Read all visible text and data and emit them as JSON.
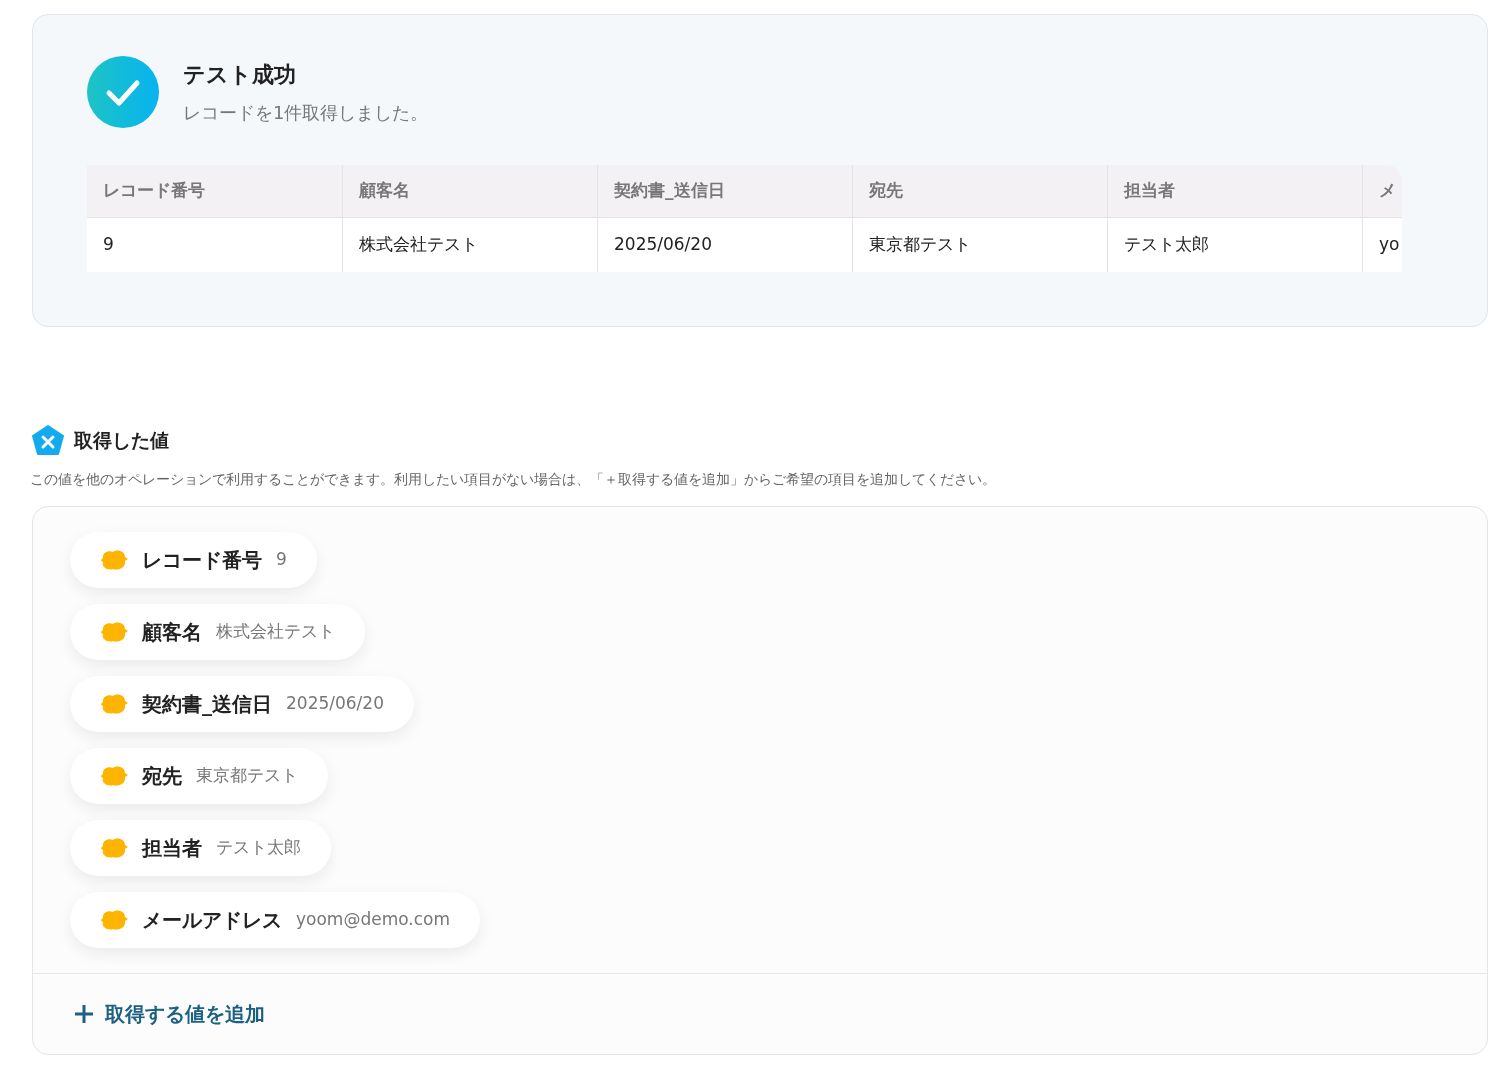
{
  "result": {
    "title": "テスト成功",
    "message": "レコードを1件取得しました。"
  },
  "table": {
    "columns": [
      "レコード番号",
      "顧客名",
      "契約書_送信日",
      "宛先",
      "担当者",
      "メ"
    ],
    "rows": [
      [
        "9",
        "株式会社テスト",
        "2025/06/20",
        "東京都テスト",
        "テスト太郎",
        "yo"
      ]
    ]
  },
  "values_section": {
    "title": "取得した値",
    "description": "この値を他のオペレーションで利用することができます。利用したい項目がない場合は、「＋取得する値を追加」からご希望の項目を追加してください。",
    "items": [
      {
        "label": "レコード番号",
        "value": "9"
      },
      {
        "label": "顧客名",
        "value": "株式会社テスト"
      },
      {
        "label": "契約書_送信日",
        "value": "2025/06/20"
      },
      {
        "label": "宛先",
        "value": "東京都テスト"
      },
      {
        "label": "担当者",
        "value": "テスト太郎"
      },
      {
        "label": "メールアドレス",
        "value": "yoom@demo.com"
      }
    ],
    "add_button": "取得する値を追加"
  }
}
